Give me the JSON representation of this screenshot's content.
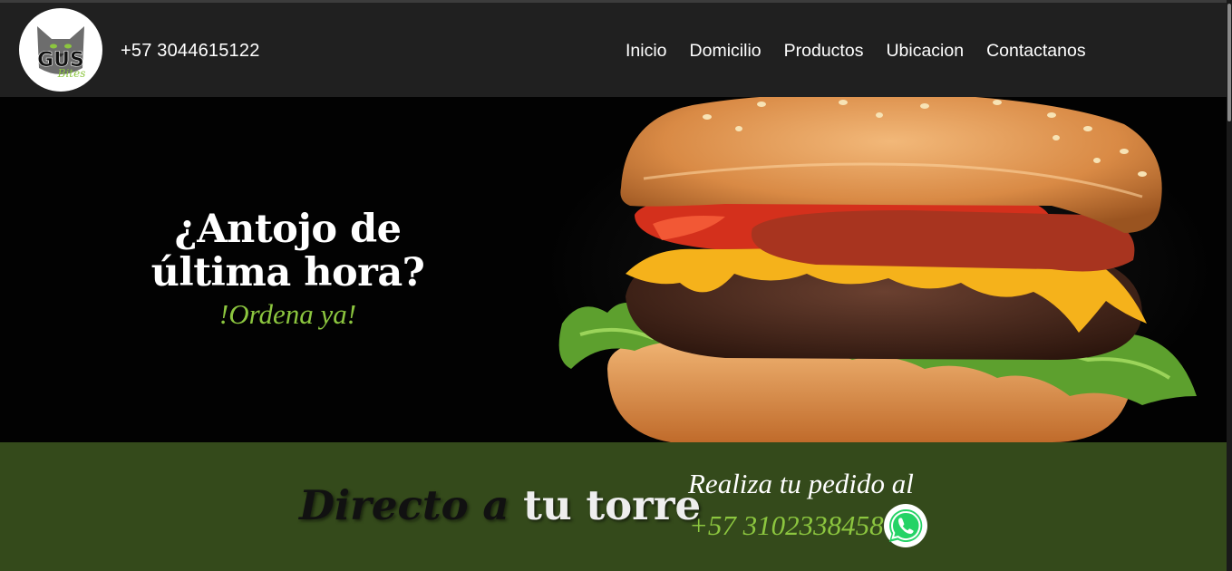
{
  "header": {
    "logo": {
      "brand": "GUS",
      "sub": "Bites"
    },
    "phone": "+57 3044615122",
    "nav": [
      "Inicio",
      "Domicilio",
      "Productos",
      "Ubicacion",
      "Contactanos"
    ]
  },
  "hero": {
    "title_line1": "¿Antojo de",
    "title_line2": "última hora?",
    "subtitle": "!Ordena ya!"
  },
  "band": {
    "title_part1": "Directo a",
    "title_part2": "tu torre",
    "order_label": "Realiza tu pedido al",
    "order_phone": "+57 3102338458"
  },
  "colors": {
    "header_bg": "#202020",
    "accent_green": "#8cc63f",
    "band_bg": "#344a1b"
  },
  "icons": {
    "logo": "cat-logo-icon",
    "whatsapp": "whatsapp-icon"
  }
}
